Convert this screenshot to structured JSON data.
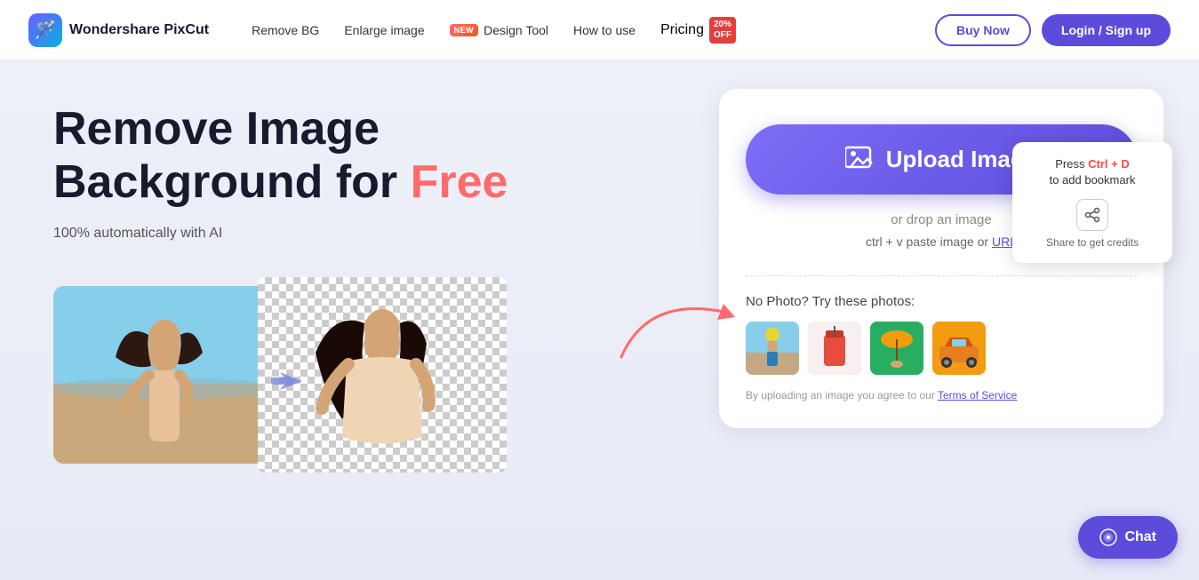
{
  "brand": {
    "logo_emoji": "🪄",
    "name": "Wondershare PixCut"
  },
  "nav": {
    "remove_bg": "Remove BG",
    "enlarge_image": "Enlarge image",
    "new_badge": "NEW",
    "design_tool": "Design Tool",
    "how_to_use": "How to use",
    "pricing": "Pricing",
    "pricing_badge_line1": "20%",
    "pricing_badge_line2": "OFF",
    "buy_now": "Buy Now",
    "login_signup": "Login / Sign up"
  },
  "hero": {
    "headline_line1": "Remove Image",
    "headline_line2": "Background for",
    "headline_free": "Free",
    "subheadline": "100% automatically with AI"
  },
  "upload": {
    "button_label": "Upload Image",
    "drop_text": "or drop an image",
    "paste_text": "ctrl + v paste image or",
    "paste_url": "URL",
    "try_photos_label": "No Photo? Try these photos:",
    "terms_text": "By uploading an image you agree to our",
    "terms_link": "Terms of Service"
  },
  "bookmark_popup": {
    "press": "Press",
    "ctrl_d": "Ctrl + D",
    "to_add": "to add bookmark",
    "share_label": "Share to get credits"
  },
  "chat": {
    "label": "Chat"
  }
}
